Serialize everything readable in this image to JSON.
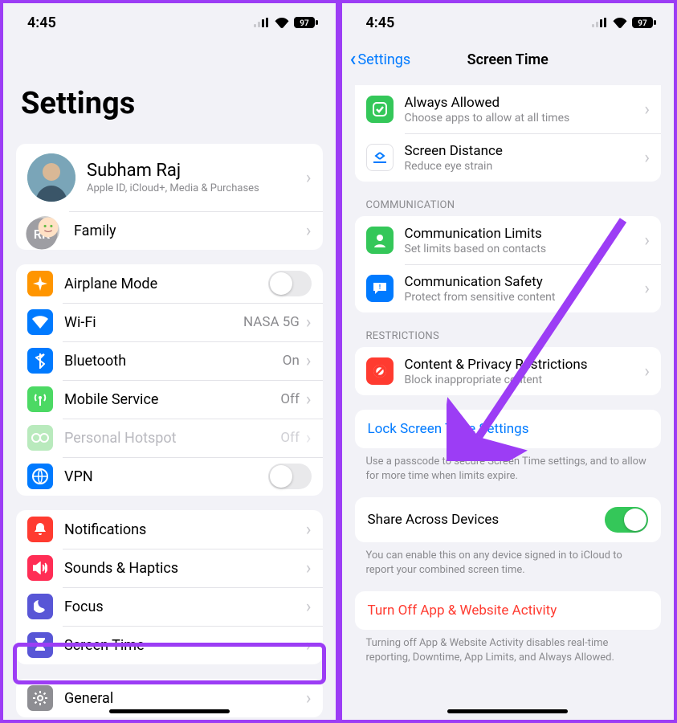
{
  "statusbar": {
    "time": "4:45",
    "battery": "97"
  },
  "left": {
    "title": "Settings",
    "profile": {
      "name": "Subham Raj",
      "sub": "Apple ID, iCloud+, Media & Purchases"
    },
    "family": "Family",
    "rows": {
      "airplane": "Airplane Mode",
      "wifi": "Wi-Fi",
      "wifi_val": "NASA 5G",
      "bt": "Bluetooth",
      "bt_val": "On",
      "mobile": "Mobile Service",
      "mobile_val": "Off",
      "hotspot": "Personal Hotspot",
      "hotspot_val": "Off",
      "vpn": "VPN",
      "notif": "Notifications",
      "sound": "Sounds & Haptics",
      "focus": "Focus",
      "screentime": "Screen Time",
      "general": "General"
    }
  },
  "right": {
    "back": "Settings",
    "title": "Screen Time",
    "always": {
      "t": "Always Allowed",
      "s": "Choose apps to allow at all times"
    },
    "distance": {
      "t": "Screen Distance",
      "s": "Reduce eye strain"
    },
    "sect_comm": "COMMUNICATION",
    "comlimits": {
      "t": "Communication Limits",
      "s": "Set limits based on contacts"
    },
    "comsafety": {
      "t": "Communication Safety",
      "s": "Protect from sensitive content"
    },
    "sect_restr": "RESTRICTIONS",
    "content": {
      "t": "Content & Privacy Restrictions",
      "s": "Block inappropriate content"
    },
    "lock": "Lock Screen Time Settings",
    "lock_foot": "Use a passcode to secure Screen Time settings, and to allow for more time when limits expire.",
    "share": "Share Across Devices",
    "share_foot": "You can enable this on any device signed in to iCloud to report your combined screen time.",
    "turnoff": "Turn Off App & Website Activity",
    "turnoff_foot": "Turning off App & Website Activity disables real-time reporting, Downtime, App Limits, and Always Allowed."
  }
}
